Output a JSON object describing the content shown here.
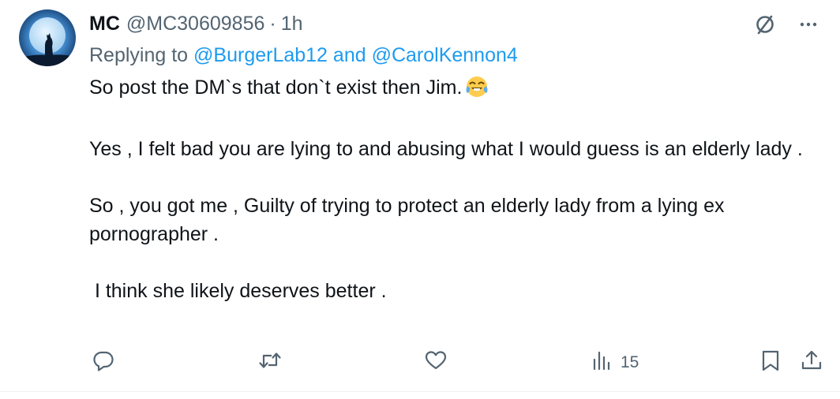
{
  "author": {
    "display_name": "MC",
    "handle": "@MC30609856",
    "separator": "·",
    "time": "1h"
  },
  "reply_context": {
    "prefix": "Replying to ",
    "mention1": "@BurgerLab12",
    "conjunction": " and ",
    "mention2": "@CarolKennon4"
  },
  "body": {
    "p1": "So post the DM`s that don`t exist then Jim.",
    "p2": "Yes , I felt bad you are lying to and abusing what I would guess is an elderly lady .",
    "p3": "So , you got me , Guilty of trying to protect an elderly lady from a lying ex pornographer .",
    "p4": " I think she likely deserves better ."
  },
  "metrics": {
    "views": "15"
  },
  "icons": {
    "avatar": "wolf-moon-avatar",
    "emoji": "face-with-tears-of-joy-emoji",
    "grok": "grok-slash-icon",
    "more": "more-dots-icon",
    "reply": "reply-icon",
    "retweet": "retweet-icon",
    "like": "heart-icon",
    "views": "analytics-icon",
    "bookmark": "bookmark-icon",
    "share": "share-icon"
  },
  "colors": {
    "text": "#0f1419",
    "secondary": "#536471",
    "link": "#1d9bf0"
  }
}
